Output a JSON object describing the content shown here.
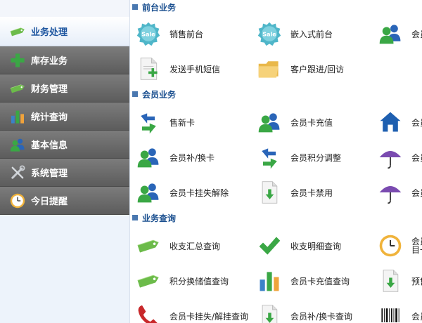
{
  "sidebar": {
    "items": [
      {
        "label": "业务处理",
        "icon": "tag-icon",
        "active": true
      },
      {
        "label": "库存业务",
        "icon": "plus-icon"
      },
      {
        "label": "财务管理",
        "icon": "tag-icon"
      },
      {
        "label": "统计查询",
        "icon": "bar-chart-icon"
      },
      {
        "label": "基本信息",
        "icon": "users-icon"
      },
      {
        "label": "系统管理",
        "icon": "tools-icon"
      },
      {
        "label": "今日提醒",
        "icon": "clock-icon"
      }
    ]
  },
  "sections": [
    {
      "title": "前台业务",
      "items": [
        {
          "label": "销售前台",
          "icon": "sale-badge-icon"
        },
        {
          "label": "嵌入式前台",
          "icon": "sale-badge-icon"
        },
        {
          "label": "会员",
          "icon": "users-icon"
        },
        {
          "label": "发送手机短信",
          "icon": "document-add-icon"
        },
        {
          "label": "客户跟进/回访",
          "icon": "folder-icon"
        }
      ]
    },
    {
      "title": "会员业务",
      "items": [
        {
          "label": "售新卡",
          "icon": "arrow-exchange-icon"
        },
        {
          "label": "会员卡充值",
          "icon": "users-icon"
        },
        {
          "label": "会员",
          "icon": "home-icon"
        },
        {
          "label": "会员补/换卡",
          "icon": "users-icon"
        },
        {
          "label": "会员积分调整",
          "icon": "arrow-exchange-icon"
        },
        {
          "label": "会员",
          "icon": "umbrella-icon"
        },
        {
          "label": "会员卡挂失解除",
          "icon": "users-icon"
        },
        {
          "label": "会员卡禁用",
          "icon": "document-download-icon"
        },
        {
          "label": "会员",
          "icon": "umbrella-icon"
        }
      ]
    },
    {
      "title": "业务查询",
      "items": [
        {
          "label": "收支汇总查询",
          "icon": "tag-icon"
        },
        {
          "label": "收支明细查询",
          "icon": "checkmark-icon"
        },
        {
          "label": "会员\n目一",
          "icon": "clock-icon"
        },
        {
          "label": "积分换储值查询",
          "icon": "tag-icon"
        },
        {
          "label": "会员卡充值查询",
          "icon": "bar-chart-icon"
        },
        {
          "label": "预售",
          "icon": "document-download-icon"
        },
        {
          "label": "会员卡挂失/解挂查询",
          "icon": "phone-icon"
        },
        {
          "label": "会员补/换卡查询",
          "icon": "document-download-icon"
        },
        {
          "label": "会员",
          "icon": "barcode-icon"
        }
      ]
    }
  ]
}
